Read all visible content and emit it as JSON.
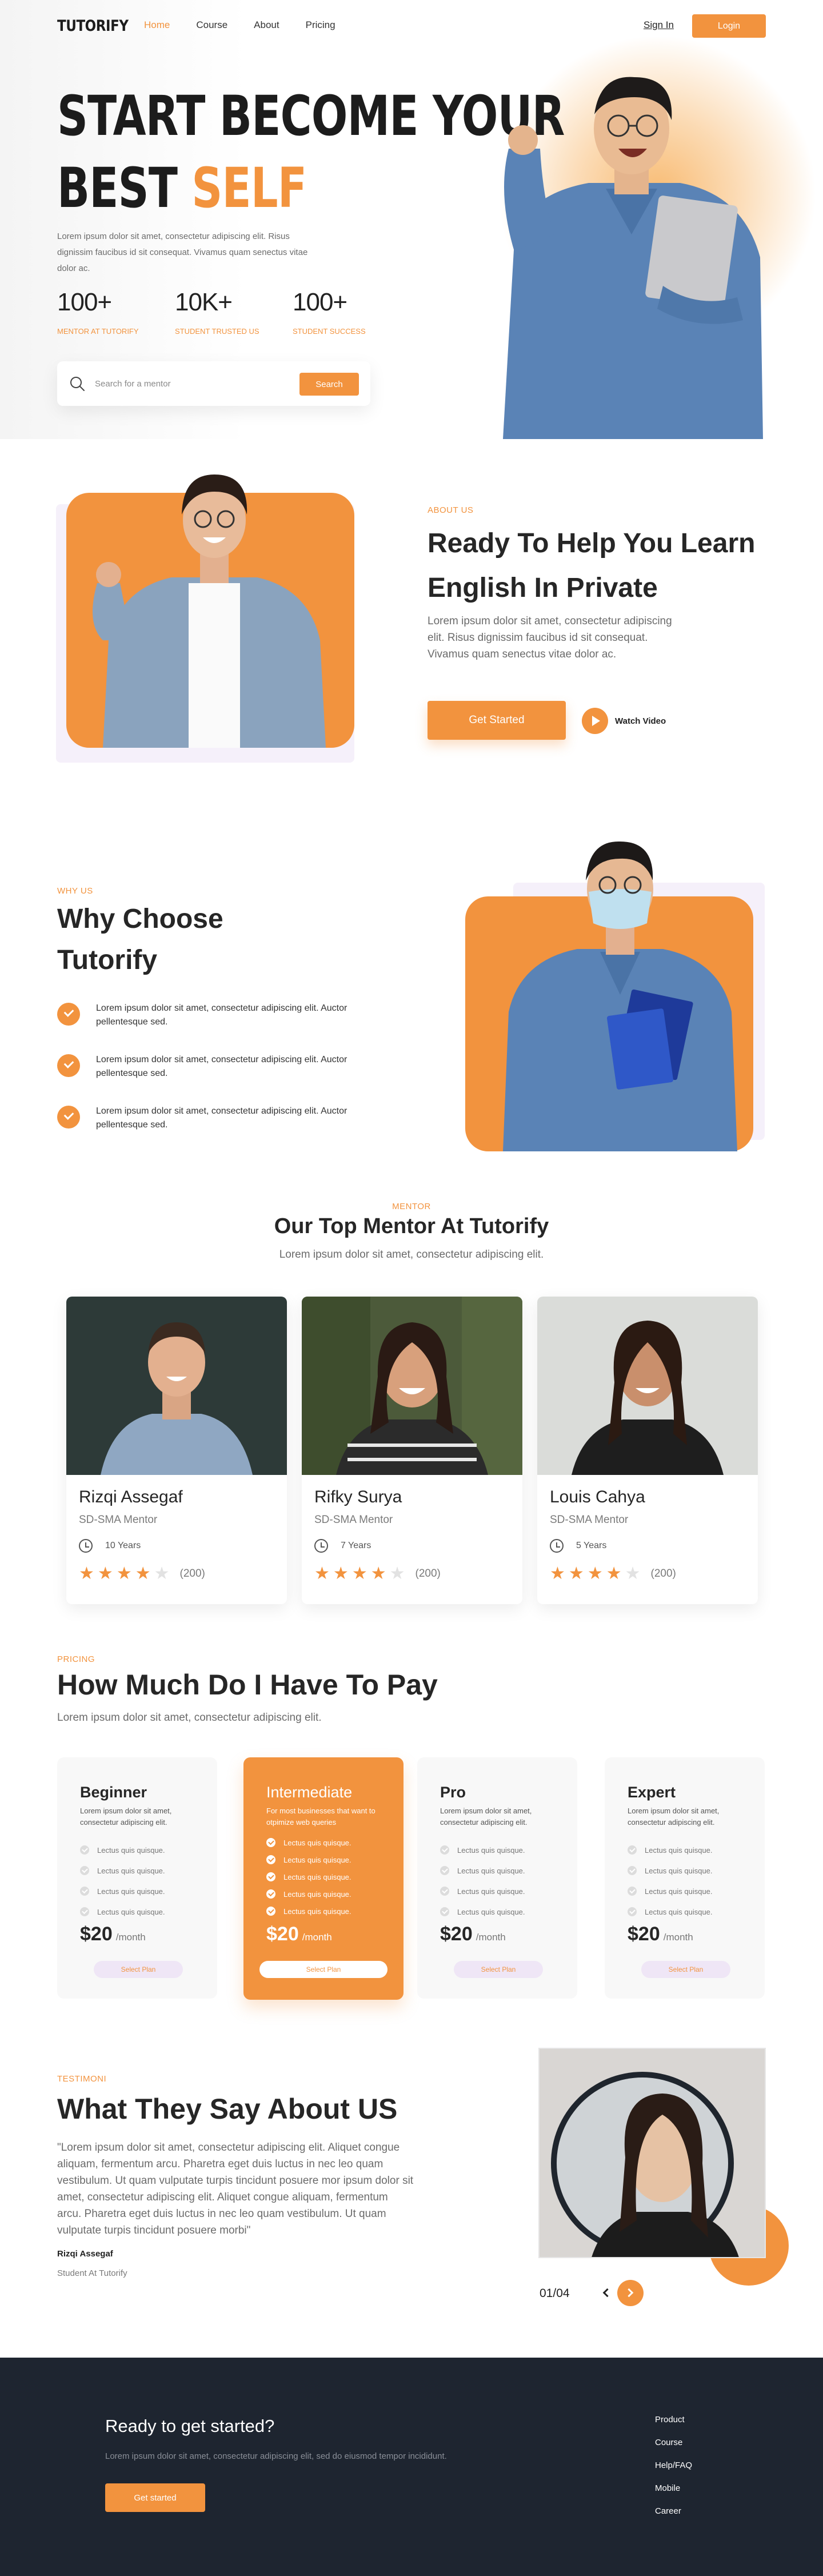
{
  "colors": {
    "accent": "#f2933e",
    "dark": "#1e2530",
    "text": "#262626",
    "muted": "#6b6b6b",
    "lavender": "#f5f0fa"
  },
  "nav": {
    "logo": "TUTORIFY",
    "items": [
      {
        "label": "Home",
        "active": true
      },
      {
        "label": "Course"
      },
      {
        "label": "About"
      },
      {
        "label": "Pricing"
      }
    ],
    "signin": "Sign In",
    "login": "Login"
  },
  "hero": {
    "title_line1": "START BECOME YOUR",
    "title_line2a": "BEST ",
    "title_line2b": "SELF",
    "description": "Lorem ipsum dolor sit amet, consectetur adipiscing elit. Risus dignissim faucibus id sit consequat. Vivamus quam senectus vitae dolor ac.",
    "stats": [
      {
        "value": "100+",
        "label": "MENTOR AT TUTORIFY"
      },
      {
        "value": "10K+",
        "label": "STUDENT TRUSTED US"
      },
      {
        "value": "100+",
        "label": "STUDENT SUCCESS"
      }
    ],
    "search_placeholder": "Search for a mentor",
    "search_button": "Search",
    "search_icon": "search-icon"
  },
  "about": {
    "eyebrow": "ABOUT US",
    "title": "Ready To Help You Learn English In Private",
    "description": "Lorem ipsum dolor sit amet, consectetur adipiscing elit. Risus dignissim faucibus id sit consequat. Vivamus quam senectus vitae dolor ac.",
    "cta": "Get Started",
    "watch": "Watch Video"
  },
  "why": {
    "eyebrow": "WHY US",
    "title": "Why Choose Tutorify",
    "items": [
      "Lorem ipsum dolor sit amet, consectetur adipiscing elit. Auctor pellentesque sed.",
      "Lorem ipsum dolor sit amet, consectetur adipiscing elit. Auctor pellentesque sed.",
      "Lorem ipsum dolor sit amet, consectetur adipiscing elit. Auctor pellentesque sed."
    ]
  },
  "mentors": {
    "eyebrow": "MENTOR",
    "title": "Our Top Mentor At Tutorify",
    "subtitle": "Lorem ipsum dolor sit amet, consectetur adipiscing elit.",
    "list": [
      {
        "name": "Rizqi Assegaf",
        "role": "SD-SMA Mentor",
        "years": "10 Years",
        "rating": 4,
        "reviews": "(200)"
      },
      {
        "name": "Rifky Surya",
        "role": "SD-SMA Mentor",
        "years": "7 Years",
        "rating": 4,
        "reviews": "(200)"
      },
      {
        "name": "Louis Cahya",
        "role": "SD-SMA Mentor",
        "years": "5 Years",
        "rating": 4,
        "reviews": "(200)"
      }
    ]
  },
  "pricing": {
    "eyebrow": "PRICING",
    "title": "How Much Do I Have To Pay",
    "subtitle": "Lorem ipsum dolor sit amet, consectetur adipiscing elit.",
    "plans": [
      {
        "name": "Beginner",
        "desc": "Lorem ipsum dolor sit amet, consectetur adipiscing elit.",
        "features": [
          "Lectus quis quisque.",
          "Lectus quis quisque.",
          "Lectus quis quisque.",
          "Lectus quis quisque."
        ],
        "price": "$20",
        "unit": "/month",
        "button": "Select Plan"
      },
      {
        "name": "Intermediate",
        "desc": "For most businesses that want to otpimize web queries",
        "features": [
          "Lectus quis quisque.",
          "Lectus quis quisque.",
          "Lectus quis quisque.",
          "Lectus quis quisque.",
          "Lectus quis quisque."
        ],
        "price": "$20",
        "unit": "/month",
        "button": "Select Plan",
        "featured": true
      },
      {
        "name": "Pro",
        "desc": "Lorem ipsum dolor sit amet, consectetur adipiscing elit.",
        "features": [
          "Lectus quis quisque.",
          "Lectus quis quisque.",
          "Lectus quis quisque.",
          "Lectus quis quisque."
        ],
        "price": "$20",
        "unit": "/month",
        "button": "Select Plan"
      },
      {
        "name": "Expert",
        "desc": "Lorem ipsum dolor sit amet, consectetur adipiscing elit.",
        "features": [
          "Lectus quis quisque.",
          "Lectus quis quisque.",
          "Lectus quis quisque.",
          "Lectus quis quisque."
        ],
        "price": "$20",
        "unit": "/month",
        "button": "Select Plan"
      }
    ]
  },
  "testimonial": {
    "eyebrow": "TESTIMONI",
    "title": "What They Say About US",
    "quote": "\"Lorem ipsum dolor sit amet, consectetur adipiscing elit. Aliquet congue aliquam, fermentum arcu. Pharetra eget duis luctus in nec leo quam vestibulum. Ut quam vulputate turpis tincidunt posuere mor ipsum dolor sit amet, consectetur adipiscing elit. Aliquet congue aliquam, fermentum arcu. Pharetra eget duis luctus in nec leo quam vestibulum. Ut quam vulputate turpis tincidunt posuere morbi\"",
    "name": "Rizqi Assegaf",
    "role": "Student At Tutorify",
    "counter": "01/04"
  },
  "footer": {
    "title": "Ready to get started?",
    "description": "Lorem ipsum dolor sit amet, consectetur adipiscing elit, sed do eiusmod tempor incididunt.",
    "cta": "Get started",
    "links": [
      "Product",
      "Course",
      "Help/FAQ",
      "Mobile",
      "Career"
    ]
  }
}
